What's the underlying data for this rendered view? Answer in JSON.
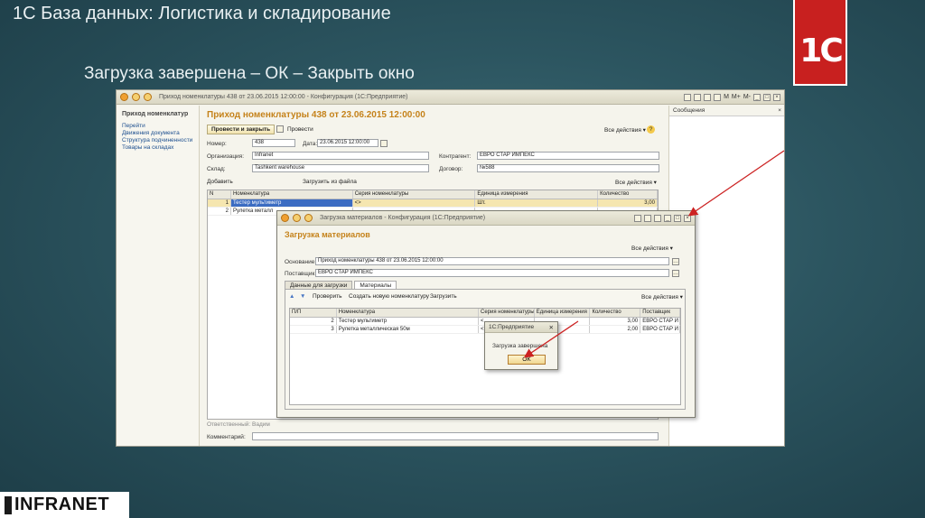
{
  "slide": {
    "title": "1С База данных: Логистика и складирование",
    "subtitle": "Загрузка завершена – ОК – Закрыть окно",
    "logo_text": "1C",
    "company_logo": "INFRANET"
  },
  "main_window": {
    "title": "Приход номенклатуры 438 от 23.06.2015 12:00:00 - Конфигурация (1С:Предприятие)",
    "toolbar_right": [
      "M",
      "M+",
      "M-"
    ],
    "left_pane": {
      "header": "Приход номенклатур",
      "links": [
        "Перейти",
        "Движения документа",
        "Структура подчиненности",
        "Товары на складах"
      ]
    },
    "messages_pane": {
      "title": "Сообщения",
      "close": "×"
    },
    "document": {
      "heading": "Приход номенклатуры 438 от 23.06.2015 12:00:00",
      "post_close_button": "Провести и закрыть",
      "post_button": "Провести",
      "all_actions": "Все действия ▾",
      "help": "?",
      "number_label": "Номер:",
      "number_value": "438",
      "date_label": "Дата:",
      "date_value": "23.06.2015 12:00:00",
      "org_label": "Организация:",
      "org_value": "Infranet",
      "counterparty_label": "Контрагент:",
      "counterparty_value": "ЕВРО СТАР ИМПЕКС",
      "warehouse_label": "Склад:",
      "warehouse_value": "Tashkent warehouse",
      "contract_label": "Договор:",
      "contract_value": "№588",
      "add_button": "Добавить",
      "load_from_file": "Загрузить из файла",
      "table_all_actions": "Все действия ▾",
      "columns": [
        "N",
        "Номенклатура",
        "Серия номенклатуры",
        "Единица измерения",
        "Количество"
      ],
      "rows": [
        [
          "1",
          "Тестер мультиметр",
          "<>",
          "Шт.",
          "3,00"
        ],
        [
          "2",
          "Рулетка  металл",
          "",
          "",
          ""
        ]
      ],
      "responsible_label": "Ответственный:",
      "responsible_value": "Вадим",
      "comment_label": "Комментарий:"
    }
  },
  "load_dialog": {
    "window_title": "Загрузка материалов - Конфигурация  (1С:Предприятие)",
    "heading": "Загрузка материалов",
    "all_actions": "Все действия ▾",
    "basis_label": "Основание:",
    "basis_value": "Приход номенклатуры 438 от 23.06.2015 12:00:00",
    "supplier_label": "Поставщик:",
    "supplier_value": "ЕВРО СТАР ИМПЕКС",
    "tabs": [
      "Данные для загрузки",
      "Материалы"
    ],
    "toolbar": {
      "check": "Проверить",
      "create": "Создать новую номенклатуру",
      "load": "Загрузить",
      "all_actions": "Все действия ▾"
    },
    "columns": [
      "П/П",
      "Номенклатура",
      "Серия номенклатуры",
      "Единица измерения",
      "Количество",
      "Поставщик"
    ],
    "rows": [
      [
        "2",
        "Тестер мультиметр",
        "<",
        "",
        "3,00",
        "ЕВРО СТАР И"
      ],
      [
        "3",
        "Рулетка  металлическая  50м",
        "<",
        "",
        "2,00",
        "ЕВРО СТАР И"
      ]
    ]
  },
  "message_box": {
    "title": "1С:Предприятие",
    "close": "✕",
    "text": "Загрузка завершена",
    "ok": "OK"
  },
  "colors": {
    "accent_arrow": "#cc2222",
    "title_orange": "#c5821a",
    "link_blue": "#1d4f8f"
  }
}
